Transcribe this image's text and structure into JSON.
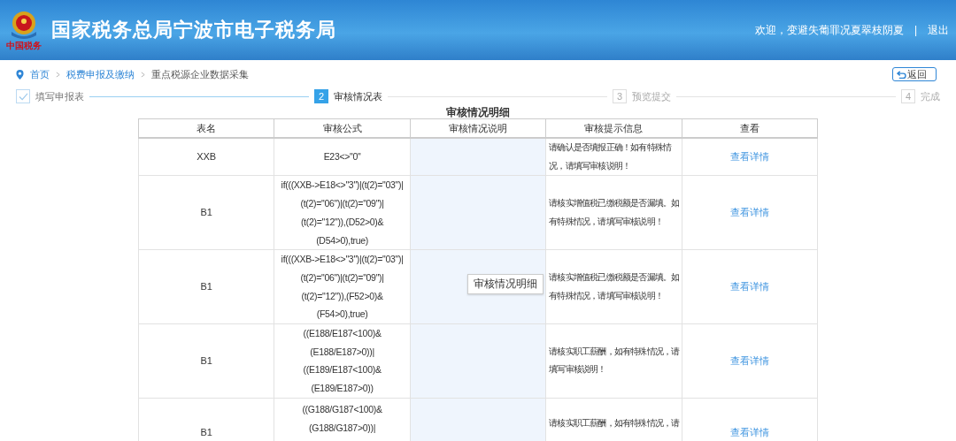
{
  "header": {
    "logo_caption": "中国税务",
    "title": "国家税务总局宁波市电子税务局",
    "welcome": "欢迎，变避失葡罪况夏翠枝阴夏",
    "separator": "|",
    "logout": "退出"
  },
  "breadcrumb": [
    "首页",
    "税费申报及缴纳",
    "重点税源企业数据采集"
  ],
  "back_button": "返回",
  "steps": [
    {
      "label": "填写申报表",
      "completed": true,
      "selected": false
    },
    {
      "number": "2",
      "label": "审核情况表",
      "completed": false,
      "selected": true
    },
    {
      "number": "3",
      "label": "预览提交",
      "completed": false,
      "selected": false
    },
    {
      "number": "4",
      "label": "完成",
      "completed": false,
      "selected": false
    }
  ],
  "table": {
    "title": "审核情况明细",
    "columns": [
      "表名",
      "审核公式",
      "审核情况说明",
      "审核提示信息",
      "查看"
    ],
    "rows": [
      {
        "table_name": "XXB",
        "formula": [
          "E23<>\"0\""
        ],
        "hint": "请确认是否填报正确！如有特殊情况，请填写审核说明！",
        "link": "查看详情"
      },
      {
        "table_name": "B1",
        "formula": [
          "if(((XXB->E18<>\"3\")|(t(2)=\"03\")|",
          "(t(2)=\"06\")|(t(2)=\"09\")|",
          "(t(2)=\"12\")),(D52>0)&",
          "(D54>0),true)"
        ],
        "hint": "请核实增值税已缴税额是否漏填。如有特殊情况，请填写审核说明！",
        "link": "查看详情"
      },
      {
        "table_name": "B1",
        "formula": [
          "if(((XXB->E18<>\"3\")|(t(2)=\"03\")|",
          "(t(2)=\"06\")|(t(2)=\"09\")|",
          "(t(2)=\"12\")),(F52>0)&",
          "(F54>0),true)"
        ],
        "hint": "请核实增值税已缴税额是否漏填。如有特殊情况，请填写审核说明！",
        "link": "查看详情"
      },
      {
        "table_name": "B1",
        "formula": [
          "((E188/E187<100)&",
          "(E188/E187>0))|",
          "((E189/E187<100)&",
          "(E189/E187>0))"
        ],
        "hint": "请核实职工薪酬，如有特殊情况，请填写审核说明！",
        "link": "查看详情"
      },
      {
        "table_name": "B1",
        "formula": [
          "((G188/G187<100)&",
          "(G188/G187>0))|"
        ],
        "hint": "请核实职工薪酬，如有特殊情况，请",
        "link": "查看详情"
      }
    ]
  },
  "tooltip": "审核情况明细"
}
